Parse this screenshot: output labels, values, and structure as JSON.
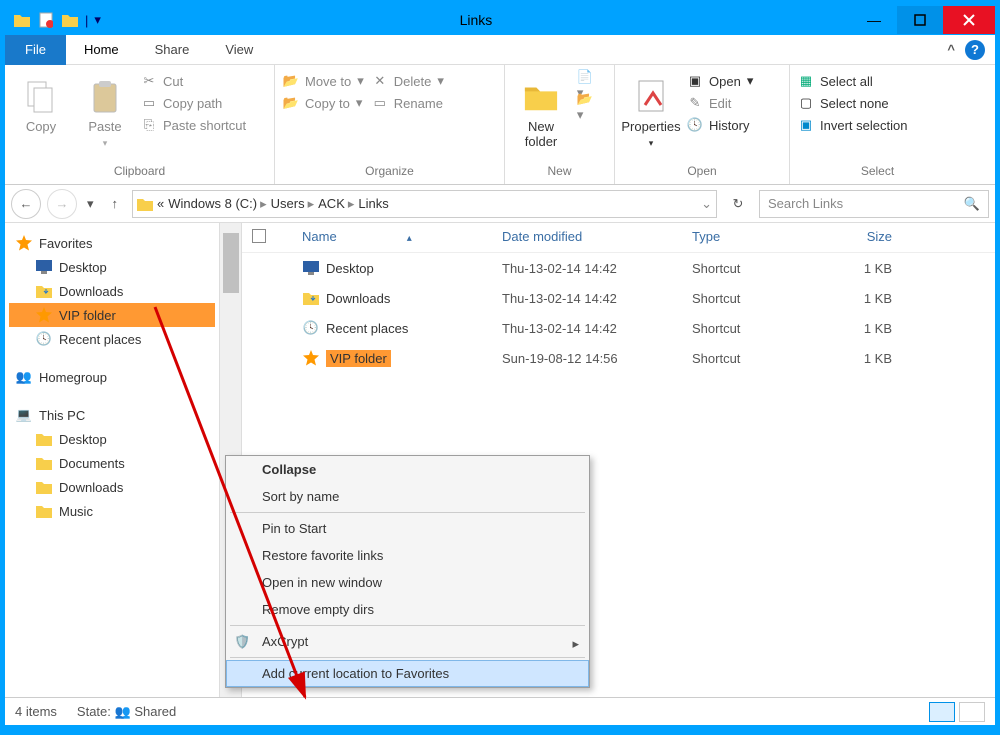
{
  "title": "Links",
  "menubar": {
    "file": "File",
    "tabs": [
      "Home",
      "Share",
      "View"
    ]
  },
  "ribbon": {
    "clipboard": {
      "label": "Clipboard",
      "copy": "Copy",
      "paste": "Paste",
      "cut": "Cut",
      "copypath": "Copy path",
      "paste_shortcut": "Paste shortcut"
    },
    "organize": {
      "label": "Organize",
      "move": "Move to",
      "copy": "Copy to",
      "delete": "Delete",
      "rename": "Rename"
    },
    "new": {
      "label": "New",
      "newfolder": "New\nfolder"
    },
    "open": {
      "label": "Open",
      "properties": "Properties",
      "open": "Open",
      "edit": "Edit",
      "history": "History"
    },
    "select": {
      "label": "Select",
      "all": "Select all",
      "none": "Select none",
      "invert": "Invert selection"
    }
  },
  "breadcrumb": {
    "root": "«",
    "parts": [
      "Windows 8 (C:)",
      "Users",
      "ACK",
      "Links"
    ]
  },
  "search": {
    "placeholder": "Search Links"
  },
  "sidebar": {
    "favorites": "Favorites",
    "fav_items": [
      "Desktop",
      "Downloads",
      "VIP folder",
      "Recent places"
    ],
    "homegroup": "Homegroup",
    "thispc": "This PC",
    "pc_items": [
      "Desktop",
      "Documents",
      "Downloads",
      "Music"
    ]
  },
  "columns": {
    "name": "Name",
    "date": "Date modified",
    "type": "Type",
    "size": "Size"
  },
  "files": [
    {
      "name": "Desktop",
      "date": "Thu-13-02-14 14:42",
      "type": "Shortcut",
      "size": "1 KB",
      "icon": "monitor"
    },
    {
      "name": "Downloads",
      "date": "Thu-13-02-14 14:42",
      "type": "Shortcut",
      "size": "1 KB",
      "icon": "folder-dl"
    },
    {
      "name": "Recent places",
      "date": "Thu-13-02-14 14:42",
      "type": "Shortcut",
      "size": "1 KB",
      "icon": "recent"
    },
    {
      "name": "VIP folder",
      "date": "Sun-19-08-12 14:56",
      "type": "Shortcut",
      "size": "1 KB",
      "icon": "star"
    }
  ],
  "context": {
    "collapse": "Collapse",
    "sort": "Sort by name",
    "pin": "Pin to Start",
    "restore": "Restore favorite links",
    "opennew": "Open in new window",
    "removeempty": "Remove empty dirs",
    "axcrypt": "AxCrypt",
    "addfav": "Add current location to Favorites"
  },
  "status": {
    "items": "4 items",
    "state": "State:",
    "shared": "Shared"
  }
}
